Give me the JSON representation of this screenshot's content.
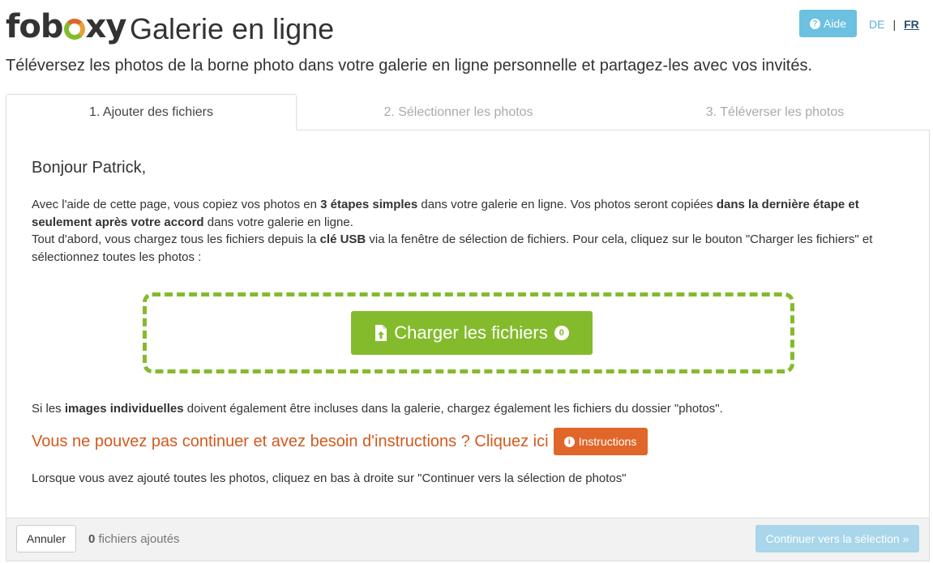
{
  "header": {
    "logo_prefix": "fob",
    "logo_suffix": "xy",
    "title": "Galerie en ligne",
    "help_label": "Aide",
    "lang_de": "DE",
    "lang_sep": "|",
    "lang_fr": "FR"
  },
  "subtitle": "Téléversez les photos de la borne photo dans votre galerie en ligne personnelle et partagez-les avec vos invités.",
  "tabs": [
    {
      "label": "1. Ajouter des fichiers",
      "active": true
    },
    {
      "label": "2. Sélectionner les photos",
      "active": false
    },
    {
      "label": "3. Téléverser les photos",
      "active": false
    }
  ],
  "main": {
    "greeting": "Bonjour Patrick,",
    "p1_a": "Avec l'aide de cette page, vous copiez vos photos en ",
    "p1_b": "3 étapes simples",
    "p1_c": " dans votre galerie en ligne. Vos photos seront copiées ",
    "p1_d": "dans la dernière étape et seulement après votre accord",
    "p1_e": " dans votre galerie en ligne.",
    "p2_a": "Tout d'abord, vous chargez tous les fichiers depuis la ",
    "p2_b": "clé USB",
    "p2_c": " via la fenêtre de sélection de fichiers. Pour cela, cliquez sur le bouton \"Charger les fichiers\" et sélectionnez toutes les photos :",
    "upload_label": "Charger les fichiers",
    "upload_count": "0",
    "single_a": "Si les ",
    "single_b": "images individuelles",
    "single_c": " doivent également être incluses dans la galerie, chargez également les fichiers du dossier \"photos\".",
    "help_text": "Vous ne pouvez pas continuer et avez besoin d'instructions ? Cliquez ici",
    "instructions_label": "Instructions",
    "final_note": "Lorsque vous avez ajouté toutes les photos, cliquez en bas à droite sur \"Continuer vers la sélection de photos\""
  },
  "footer": {
    "cancel_label": "Annuler",
    "count_number": "0",
    "count_text": " fichiers ajoutés",
    "continue_label": "Continuer vers la sélection »"
  },
  "colors": {
    "green": "#84bb2c",
    "orange": "#e0662a",
    "blue": "#6cc0e0"
  }
}
